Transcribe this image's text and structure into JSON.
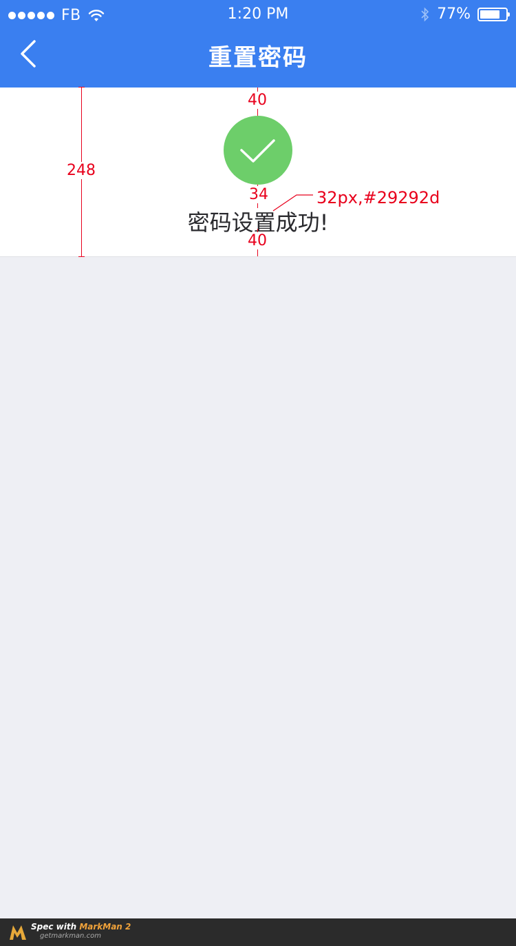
{
  "status_bar": {
    "carrier": "FB",
    "time": "1:20 PM",
    "battery": "77%"
  },
  "header": {
    "title": "重置密码"
  },
  "result": {
    "message": "密码设置成功!"
  },
  "annotations": {
    "top_gap": "40",
    "mid_gap": "34",
    "bottom_gap": "40",
    "card_height": "248",
    "font_spec": "32px,#29292d"
  },
  "footer": {
    "label": "Spec with",
    "brand": "MarkMan 2",
    "url": "getmarkman.com"
  },
  "colors": {
    "header_bg": "#3a7ff0",
    "success": "#6dce6a",
    "text": "#29292d",
    "page_bg": "#eeeff4",
    "annotation": "#e8001c"
  },
  "icons": [
    "signal-dots",
    "wifi-icon",
    "bluetooth-icon",
    "battery-icon",
    "back-icon",
    "check-icon"
  ]
}
